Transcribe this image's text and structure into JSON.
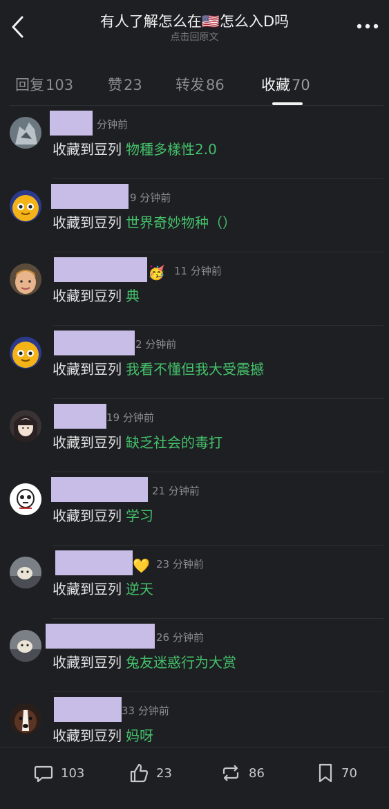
{
  "header": {
    "title": "有人了解怎么在🇺🇸怎么入D吗",
    "subtitle": "点击回原文"
  },
  "tabs": [
    {
      "label": "回复",
      "count": "103",
      "active": false
    },
    {
      "label": "赞",
      "count": "23",
      "active": false
    },
    {
      "label": "转发",
      "count": "86",
      "active": false
    },
    {
      "label": "收藏",
      "count": "70",
      "active": true
    }
  ],
  "items": [
    {
      "time": "分钟前",
      "verb": "收藏到豆列",
      "target": "物種多樣性2.0",
      "avatar": "grey-creature",
      "emoji": ""
    },
    {
      "time": "9 分钟前",
      "verb": "收藏到豆列",
      "target": "世界奇妙物种（）",
      "avatar": "orange-cartoon",
      "emoji": ""
    },
    {
      "time": "11 分钟前",
      "verb": "收藏到豆列",
      "target": "典",
      "avatar": "person-face",
      "emoji": "🥳"
    },
    {
      "time": "2 分钟前",
      "verb": "收藏到豆列",
      "target": "我看不懂但我大受震撼",
      "avatar": "orange-cartoon",
      "emoji": ""
    },
    {
      "time": "19 分钟前",
      "verb": "收藏到豆列",
      "target": "缺乏社会的毒打",
      "avatar": "anime-girl",
      "emoji": ""
    },
    {
      "time": "21 分钟前",
      "verb": "收藏到豆列",
      "target": "学习",
      "avatar": "white-doodle",
      "emoji": ""
    },
    {
      "time": "23 分钟前",
      "verb": "收藏到豆列",
      "target": "逆天",
      "avatar": "cat-photo",
      "emoji": "💛"
    },
    {
      "time": "26 分钟前",
      "verb": "收藏到豆列",
      "target": "兔友迷惑行为大赏",
      "avatar": "cat-photo",
      "emoji": ""
    },
    {
      "time": "33 分钟前",
      "verb": "收藏到豆列",
      "target": "妈呀",
      "avatar": "dog-photo",
      "emoji": ""
    }
  ],
  "bottom": {
    "reply_count": "103",
    "like_count": "23",
    "repost_count": "86",
    "collect_count": "70"
  },
  "colors": {
    "background": "#1e1f23",
    "accent_green": "#44c16a",
    "redaction": "#c8bde6"
  }
}
